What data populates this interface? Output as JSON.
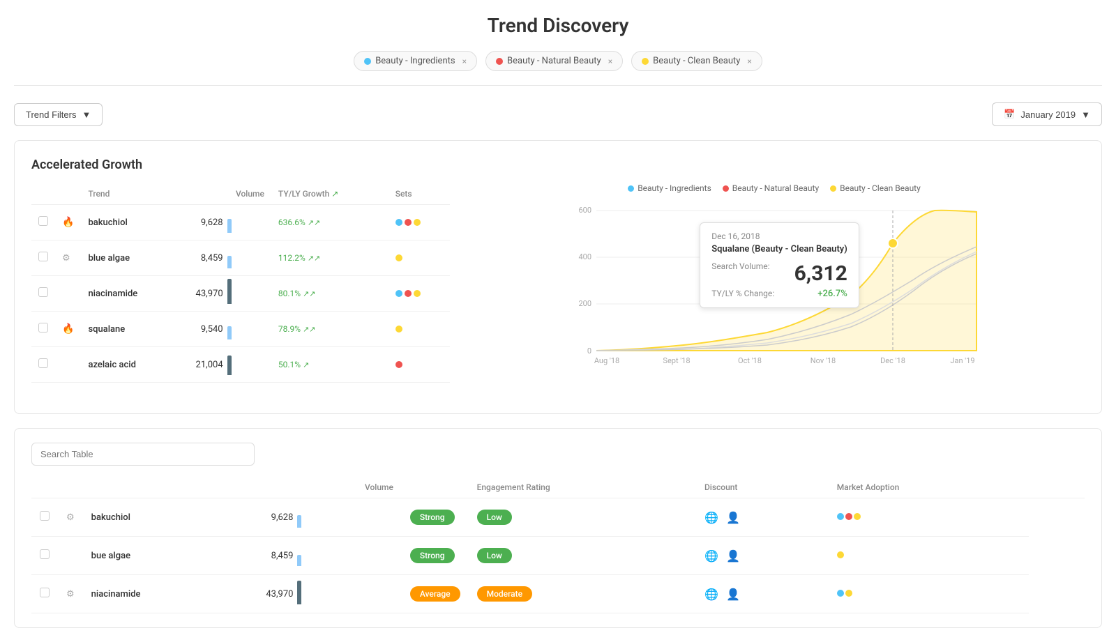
{
  "page": {
    "title": "Trend Discovery"
  },
  "tags": [
    {
      "id": "ingredients",
      "label": "Beauty - Ingredients",
      "color": "#4fc3f7"
    },
    {
      "id": "natural",
      "label": "Beauty - Natural Beauty",
      "color": "#ef5350"
    },
    {
      "id": "clean",
      "label": "Beauty - Clean Beauty",
      "color": "#fdd835"
    }
  ],
  "controls": {
    "filter_label": "Trend Filters",
    "date_label": "January 2019"
  },
  "accelerated_growth": {
    "title": "Accelerated Growth",
    "columns": {
      "trend": "Trend",
      "volume": "Volume",
      "growth": "TY/LY Growth",
      "sets": "Sets"
    },
    "rows": [
      {
        "name": "bakuchiol",
        "hot": true,
        "gear": false,
        "volume": 9628,
        "volume_bar_height": 20,
        "volume_bar_color": "#90caf9",
        "growth_pct": "636.6%",
        "growth_arrows": "↗↗",
        "sets": [
          "#4fc3f7",
          "#ef5350",
          "#fdd835"
        ]
      },
      {
        "name": "blue algae",
        "hot": false,
        "gear": true,
        "volume": 8459,
        "volume_bar_height": 18,
        "volume_bar_color": "#90caf9",
        "growth_pct": "112.2%",
        "growth_arrows": "↗↗",
        "sets": [
          "#fdd835"
        ]
      },
      {
        "name": "niacinamide",
        "hot": false,
        "gear": false,
        "volume": 43970,
        "volume_bar_height": 36,
        "volume_bar_color": "#546e7a",
        "growth_pct": "80.1%",
        "growth_arrows": "↗↗",
        "sets": [
          "#4fc3f7",
          "#ef5350",
          "#fdd835"
        ]
      },
      {
        "name": "squalane",
        "hot": true,
        "gear": false,
        "volume": 9540,
        "volume_bar_height": 19,
        "volume_bar_color": "#90caf9",
        "growth_pct": "78.9%",
        "growth_arrows": "↗↗",
        "sets": [
          "#fdd835"
        ]
      },
      {
        "name": "azelaic acid",
        "hot": false,
        "gear": false,
        "volume": 21004,
        "volume_bar_height": 28,
        "volume_bar_color": "#546e7a",
        "growth_pct": "50.1%",
        "growth_arrows": "↗",
        "sets": [
          "#ef5350"
        ]
      }
    ]
  },
  "chart": {
    "legend": [
      {
        "label": "Beauty - Ingredients",
        "color": "#4fc3f7"
      },
      {
        "label": "Beauty - Natural Beauty",
        "color": "#ef5350"
      },
      {
        "label": "Beauty - Clean Beauty",
        "color": "#fdd835"
      }
    ],
    "x_labels": [
      "Aug '18",
      "Sept '18",
      "Oct '18",
      "Nov '18",
      "Dec '18",
      "Jan '19"
    ],
    "y_labels": [
      "0",
      "200",
      "400",
      "600"
    ],
    "tooltip": {
      "date": "Dec 16, 2018",
      "title": "Squalane (Beauty - Clean Beauty)",
      "search_volume_label": "Search Volume:",
      "search_volume_value": "6,312",
      "change_label": "TY/LY % Change:",
      "change_value": "+26.7%"
    }
  },
  "bottom_table": {
    "search_placeholder": "Search Table",
    "columns": {
      "volume": "Volume",
      "engagement": "Engagement Rating",
      "discount": "Discount",
      "adoption": "Market Adoption"
    },
    "rows": [
      {
        "name": "bakuchiol",
        "gear": true,
        "volume": 9628,
        "volume_bar_height": 18,
        "volume_bar_color": "#90caf9",
        "engagement": "Strong",
        "engagement_class": "strong",
        "discount": "Low",
        "discount_class": "low",
        "globe": false,
        "user": false,
        "sets": [
          "#4fc3f7",
          "#ef5350",
          "#fdd835"
        ]
      },
      {
        "name": "bue algae",
        "gear": false,
        "volume": 8459,
        "volume_bar_height": 16,
        "volume_bar_color": "#90caf9",
        "engagement": "Strong",
        "engagement_class": "strong",
        "discount": "Low",
        "discount_class": "low",
        "globe": true,
        "user": false,
        "sets": [
          "#fdd835"
        ]
      },
      {
        "name": "niacinamide",
        "gear": true,
        "volume": 43970,
        "volume_bar_height": 34,
        "volume_bar_color": "#546e7a",
        "engagement": "Average",
        "engagement_class": "average",
        "discount": "Moderate",
        "discount_class": "moderate",
        "globe": true,
        "user": true,
        "sets": [
          "#4fc3f7",
          "#fdd835"
        ]
      }
    ]
  }
}
